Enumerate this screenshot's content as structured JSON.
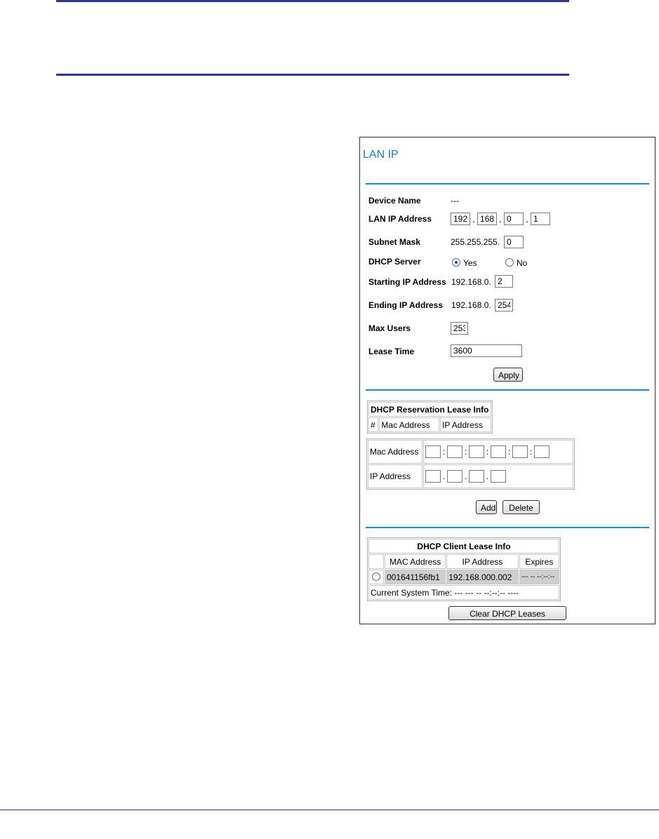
{
  "panel": {
    "title": "LAN IP",
    "device_name": {
      "label": "Device Name",
      "value": "---"
    },
    "lan_ip": {
      "label": "LAN IP Address",
      "octets": [
        "192",
        "168",
        "0",
        "1"
      ]
    },
    "subnet": {
      "label": "Subnet Mask",
      "prefix": "255.255.255.",
      "last": "0"
    },
    "dhcp_server": {
      "label": "DHCP Server",
      "yes": "Yes",
      "no": "No",
      "selected": "Yes"
    },
    "starting_ip": {
      "label": "Starting IP Address",
      "prefix": "192.168.0.",
      "value": "2"
    },
    "ending_ip": {
      "label": "Ending IP Address",
      "prefix": "192.168.0.",
      "value": "254"
    },
    "max_users": {
      "label": "Max Users",
      "value": "253"
    },
    "lease_time": {
      "label": "Lease Time",
      "value": "3600"
    },
    "apply_label": "Apply",
    "reservation": {
      "title": "DHCP Reservation Lease Info",
      "columns": [
        "#",
        "Mac Address",
        "IP Address"
      ],
      "mac_label": "Mac Address",
      "ip_label": "IP Address",
      "add_label": "Add",
      "delete_label": "Delete"
    },
    "client_lease": {
      "title": "DHCP Client Lease Info",
      "columns": [
        "MAC Address",
        "IP Address",
        "Expires"
      ],
      "rows": [
        {
          "mac": "001641156fb1",
          "ip": "192.168.000.002",
          "expires": "--- -- --:--:--"
        }
      ],
      "system_time": "Current System Time: --- --- -- --:--:-- ----",
      "clear_label": "Clear DHCP Leases"
    }
  }
}
